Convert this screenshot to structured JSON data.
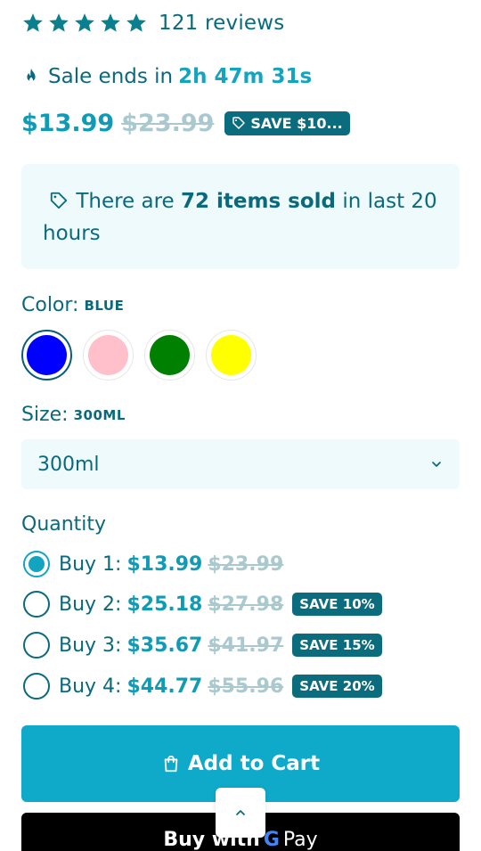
{
  "rating": {
    "stars": 5,
    "reviews_text": "121 reviews"
  },
  "sale": {
    "icon": "fire-icon",
    "text": "Sale ends in",
    "countdown": "2h 47m 31s"
  },
  "pricing": {
    "price": "$13.99",
    "compare_price": "$23.99",
    "save_badge": "SAVE $10...",
    "badge_icon": "tag-icon"
  },
  "sold_notice": {
    "icon": "tag-icon",
    "prefix": "There are",
    "strong": "72 items sold",
    "suffix": "in last 20 hours"
  },
  "color": {
    "label": "Color:",
    "selected": "BLUE",
    "swatches": [
      {
        "name": "Blue",
        "hex": "#0000ff",
        "selected": true
      },
      {
        "name": "Pink",
        "hex": "#ffc0cb",
        "selected": false
      },
      {
        "name": "Green",
        "hex": "#008000",
        "selected": false
      },
      {
        "name": "Yellow",
        "hex": "#ffff00",
        "selected": false
      }
    ]
  },
  "size": {
    "label": "Size:",
    "selected": "300ML",
    "select_value": "300ml"
  },
  "quantity": {
    "title": "Quantity",
    "options": [
      {
        "label": "Buy 1:",
        "price": "$13.99",
        "compare": "$23.99",
        "badge": "",
        "checked": true
      },
      {
        "label": "Buy 2:",
        "price": "$25.18",
        "compare": "$27.98",
        "badge": "SAVE 10%",
        "checked": false
      },
      {
        "label": "Buy 3:",
        "price": "$35.67",
        "compare": "$41.97",
        "badge": "SAVE 15%",
        "checked": false
      },
      {
        "label": "Buy 4:",
        "price": "$44.77",
        "compare": "$55.96",
        "badge": "SAVE 20%",
        "checked": false
      }
    ]
  },
  "buttons": {
    "add_to_cart": "Add to Cart",
    "gpay_prefix": "Buy with",
    "gpay_g": "G",
    "gpay_pay": "Pay"
  },
  "colors": {
    "accent": "#0faaca",
    "primary_text": "#0a6a7c",
    "badge_bg": "#0b6c7e",
    "soft_bg": "#eefafc"
  }
}
